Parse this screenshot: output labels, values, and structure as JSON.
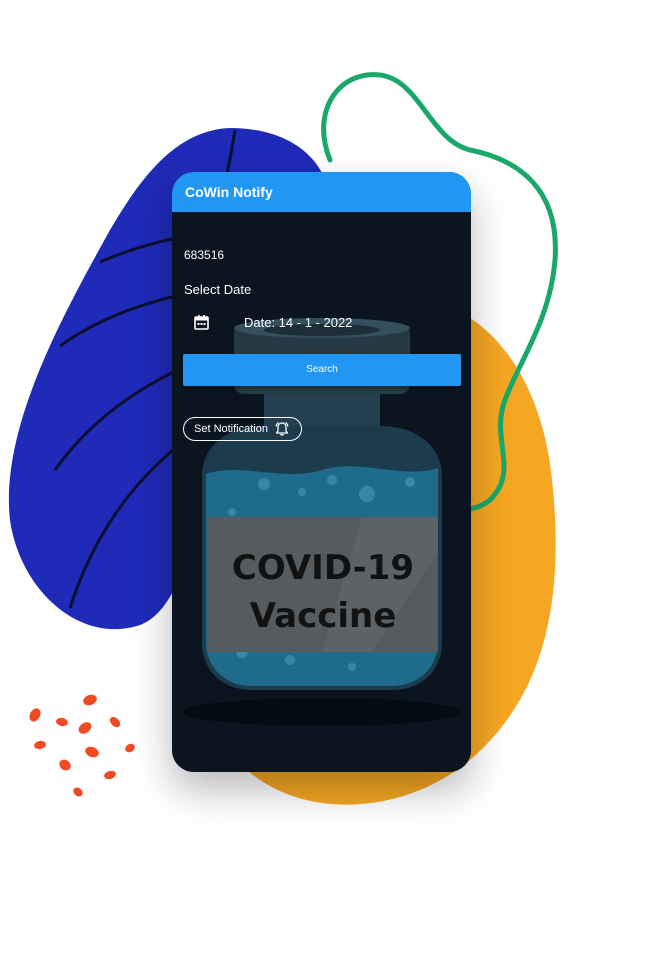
{
  "app": {
    "title": "CoWin Notify"
  },
  "form": {
    "pincode": "683516",
    "select_date_label": "Select Date",
    "date_text": "Date: 14 - 1 - 2022",
    "search_label": "Search",
    "notify_label": "Set Notification"
  },
  "artwork": {
    "vaccine_line1": "COVID-19",
    "vaccine_line2": "Vaccine"
  },
  "colors": {
    "primary": "#2196f3",
    "screen_bg": "#0a1520",
    "blob_blue": "#1f2ab8",
    "blob_orange": "#f5a623",
    "squiggle_green": "#19a86a",
    "confetti": "#ef4a23"
  },
  "icons": [
    "calendar-icon",
    "bell-icon"
  ]
}
